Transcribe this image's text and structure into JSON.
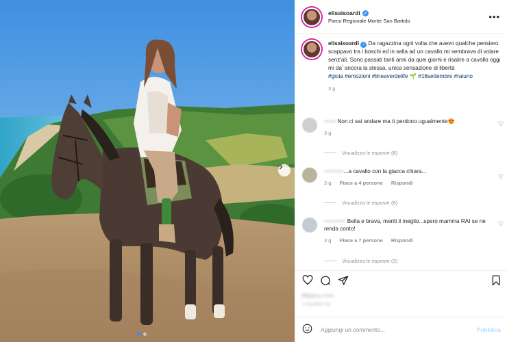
{
  "post": {
    "username": "elisaisoardi",
    "location": "Parco Regionale Monte San Bartolo",
    "more_label": "•••",
    "caption_text": " Da ragazzina ogni volta che avevo qualche pensiero scappavo tra i boschi ed in sella ad un cavallo mi sembrava di volare senz'ali. Sono passati tanti anni da quei giorni e risalire a cavallo oggi mi da' ancora la stessa, unica sensazione di libertà",
    "hashtags": "#gioia #emozioni #lineaverdelife 🌱 #16settembre #raiuno",
    "caption_time": "3 g"
  },
  "comments": [
    {
      "username": "••••••",
      "text": " Non ci sai andare ma ti perdono ugualmente😍",
      "time": "3 g",
      "likes": "",
      "reply_label": "",
      "replies_label": "Visualizza le risposte (8)"
    },
    {
      "username": "••••••••••",
      "text": "...a cavallo con la giacca chiara...",
      "time": "3 g",
      "likes": "Piace a 4 persone",
      "reply_label": "Rispondi",
      "replies_label": "Visualizza le risposte (6)"
    },
    {
      "username": "•••••••••••",
      "text": " Bella e brava, meriti il meglio...spero mamma RAI se ne renda conto!",
      "time": "3 g",
      "likes": "Piace a 7 persone",
      "reply_label": "Rispondi",
      "replies_label": "Visualizza le risposte (3)"
    }
  ],
  "comment_box": {
    "placeholder": "Aggiungi un commento...",
    "publish_label": "Pubblica",
    "emoji_icon": "smiley-icon"
  },
  "likes_blurred": "Piace a ••••••",
  "likes_sub_blurred": "3 GIORNI FA",
  "icons": [
    "heart-icon",
    "comment-icon",
    "share-icon",
    "bookmark-icon",
    "chevron-right-icon"
  ],
  "colors": {
    "story_ring": "#d6249f",
    "verified": "#3897f0",
    "link": "#00376b",
    "publish": "#b3dbff",
    "dot_active": "#3b8ef0"
  }
}
